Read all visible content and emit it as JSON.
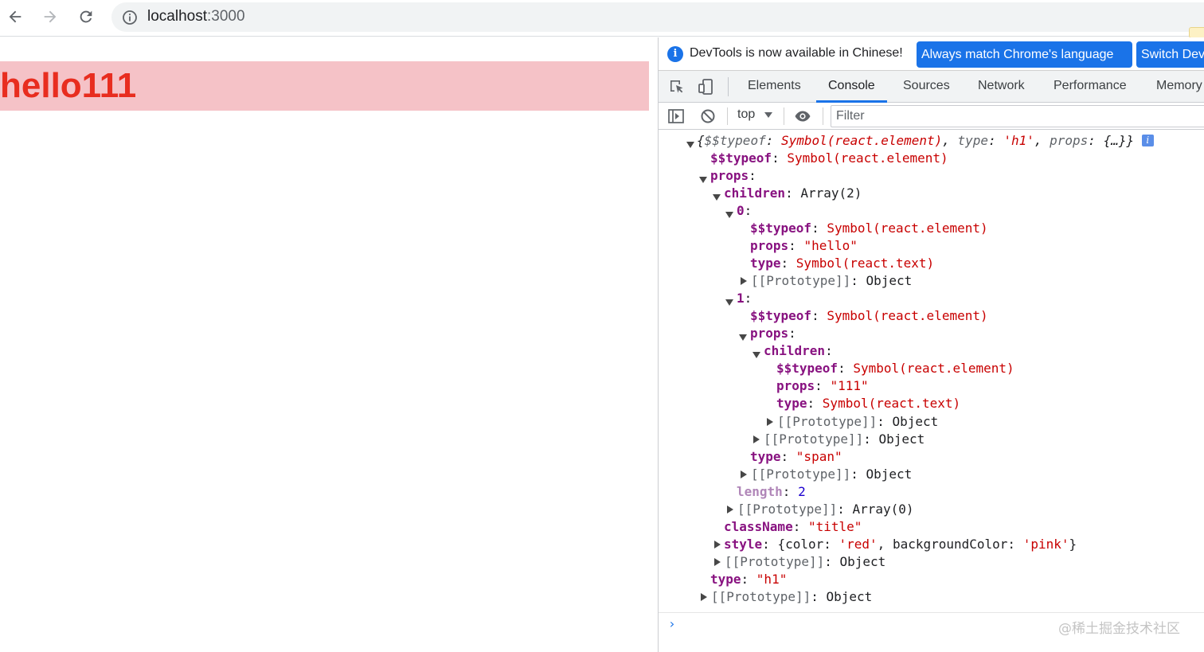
{
  "browser": {
    "back_icon": "arrow-left-icon",
    "forward_icon": "arrow-right-icon",
    "reload_icon": "reload-icon",
    "site_info_icon": "info-circle-icon",
    "url_host": "localhost",
    "url_port": ":3000"
  },
  "page": {
    "heading": "hello111",
    "heading_color": "#e82d1f",
    "heading_background": "#f5c2c7"
  },
  "devtools": {
    "infobar": {
      "message": "DevTools is now available in Chinese!",
      "match_button": "Always match Chrome's language",
      "switch_button": "Switch DevTools to Chinese"
    },
    "tabs": [
      "Elements",
      "Console",
      "Sources",
      "Network",
      "Performance",
      "Memory"
    ],
    "active_tab": "Console",
    "console_toolbar": {
      "context": "top",
      "filter_placeholder": "Filter"
    },
    "output": {
      "summary": {
        "open": "{",
        "typeof_key": "$$typeof",
        "typeof_val": "Symbol(react.element)",
        "type_key": "type",
        "type_val": "'h1'",
        "props_key": "props",
        "props_val": "{…}",
        "close": "}"
      },
      "lines": {
        "l1_key": "$$typeof",
        "l1_val": "Symbol(react.element)",
        "l2_key": "props",
        "l3_key": "children",
        "l3_val": "Array(2)",
        "l4_key": "0",
        "l5_key": "$$typeof",
        "l5_val": "Symbol(react.element)",
        "l6_key": "props",
        "l6_val": "\"hello\"",
        "l7_key": "type",
        "l7_val": "Symbol(react.text)",
        "l8_key": "[[Prototype]]",
        "l8_val": "Object",
        "l9_key": "1",
        "l10_key": "$$typeof",
        "l10_val": "Symbol(react.element)",
        "l11_key": "props",
        "l12_key": "children",
        "l13_key": "$$typeof",
        "l13_val": "Symbol(react.element)",
        "l14_key": "props",
        "l14_val": "\"111\"",
        "l15_key": "type",
        "l15_val": "Symbol(react.text)",
        "l16_key": "[[Prototype]]",
        "l16_val": "Object",
        "l17_key": "[[Prototype]]",
        "l17_val": "Object",
        "l18_key": "type",
        "l18_val": "\"span\"",
        "l19_key": "[[Prototype]]",
        "l19_val": "Object",
        "l20_key": "length",
        "l20_val": "2",
        "l21_key": "[[Prototype]]",
        "l21_val": "Array(0)",
        "l22_key": "className",
        "l22_val": "\"title\"",
        "l23_key": "style",
        "l23_a": "{color: ",
        "l23_b": "'red'",
        "l23_c": ", backgroundColor: ",
        "l23_d": "'pink'",
        "l23_e": "}",
        "l24_key": "[[Prototype]]",
        "l24_val": "Object",
        "l25_key": "type",
        "l25_val": "\"h1\"",
        "l26_key": "[[Prototype]]",
        "l26_val": "Object"
      }
    },
    "prompt": "›",
    "watermark": "@稀土掘金技术社区"
  }
}
